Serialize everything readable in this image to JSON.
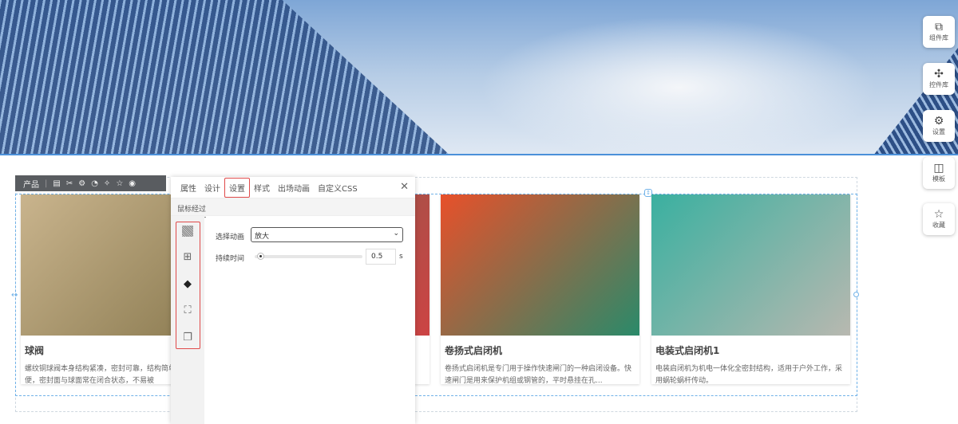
{
  "sidebar": {
    "items": [
      {
        "label": "组件库",
        "icon": "layers-icon"
      },
      {
        "label": "控件库",
        "icon": "puzzle-icon"
      },
      {
        "label": "设置",
        "icon": "gear-icon"
      },
      {
        "label": "模板",
        "icon": "template-icon"
      },
      {
        "label": "收藏",
        "icon": "star-icon"
      }
    ]
  },
  "toolbar": {
    "label": "产品"
  },
  "products": [
    {
      "title": "球阀",
      "desc": "螺纹铜球阀本身结构紧凑，密封可靠，结构简单，维修方便，密封面与球面常在闭合状态，不易被",
      "colors": [
        "#c9b48d",
        "#8a7a50"
      ]
    },
    {
      "title": "",
      "desc": "",
      "colors": [
        "#8a5a4a",
        "#c44"
      ]
    },
    {
      "title": "卷扬式启闭机",
      "desc": "卷扬式启闭机是专门用于操作快速闸门的一种启闭设备。快速闸门是用来保护机组或钢管的，平时悬挂在孔...",
      "colors": [
        "#e8502a",
        "#2a8a6a"
      ]
    },
    {
      "title": "电装式启闭机1",
      "desc": "电装启闭机为机电一体化全密封结构，适用于户外工作，采用蜗轮蜗杆传动。",
      "colors": [
        "#3ab0a0",
        "#b8b8b0"
      ]
    }
  ],
  "panel": {
    "tabs": [
      "属性",
      "设计",
      "设置",
      "样式",
      "出场动画",
      "自定义CSS"
    ],
    "active_tab": "设置",
    "subtab": "鼠标经过",
    "animation_label": "选择动画",
    "animation_value": "放大",
    "duration_label": "持续时间",
    "duration_value": "0.5",
    "duration_unit": "s",
    "duration_fraction": 0.02
  }
}
